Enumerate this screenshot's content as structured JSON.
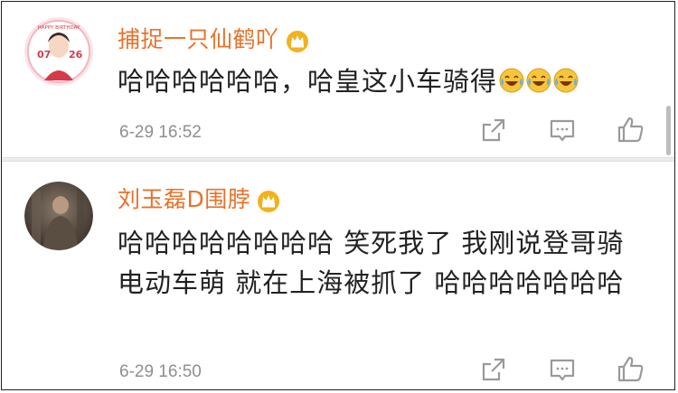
{
  "colors": {
    "username": "#e8722a",
    "text": "#222222",
    "timestamp": "#8f8f8f",
    "icon": "#9a9a9a",
    "crown": "#f2b21b",
    "divider": "#ececec"
  },
  "comments": [
    {
      "username": "捕捉一只仙鹤吖",
      "badge": "crown-icon",
      "avatar_text_top": "HAPPY BIRTHDAY",
      "avatar_text_left": "07",
      "avatar_text_right": "26",
      "content": "哈哈哈哈哈哈，哈皇这小车骑得",
      "emoji": [
        "laugh-cry-emoji",
        "laugh-cry-emoji",
        "laugh-cry-emoji"
      ],
      "timestamp": "6-29 16:52",
      "actions": [
        "share-icon",
        "comment-icon",
        "like-icon"
      ]
    },
    {
      "username": "刘玉磊D围脖",
      "badge": "crown-icon",
      "content": "哈哈哈哈哈哈哈哈 笑死我了 我刚说登哥骑电动车萌 就在上海被抓了 哈哈哈哈哈哈哈",
      "timestamp": "6-29 16:50",
      "actions": [
        "share-icon",
        "comment-icon",
        "like-icon"
      ]
    }
  ]
}
